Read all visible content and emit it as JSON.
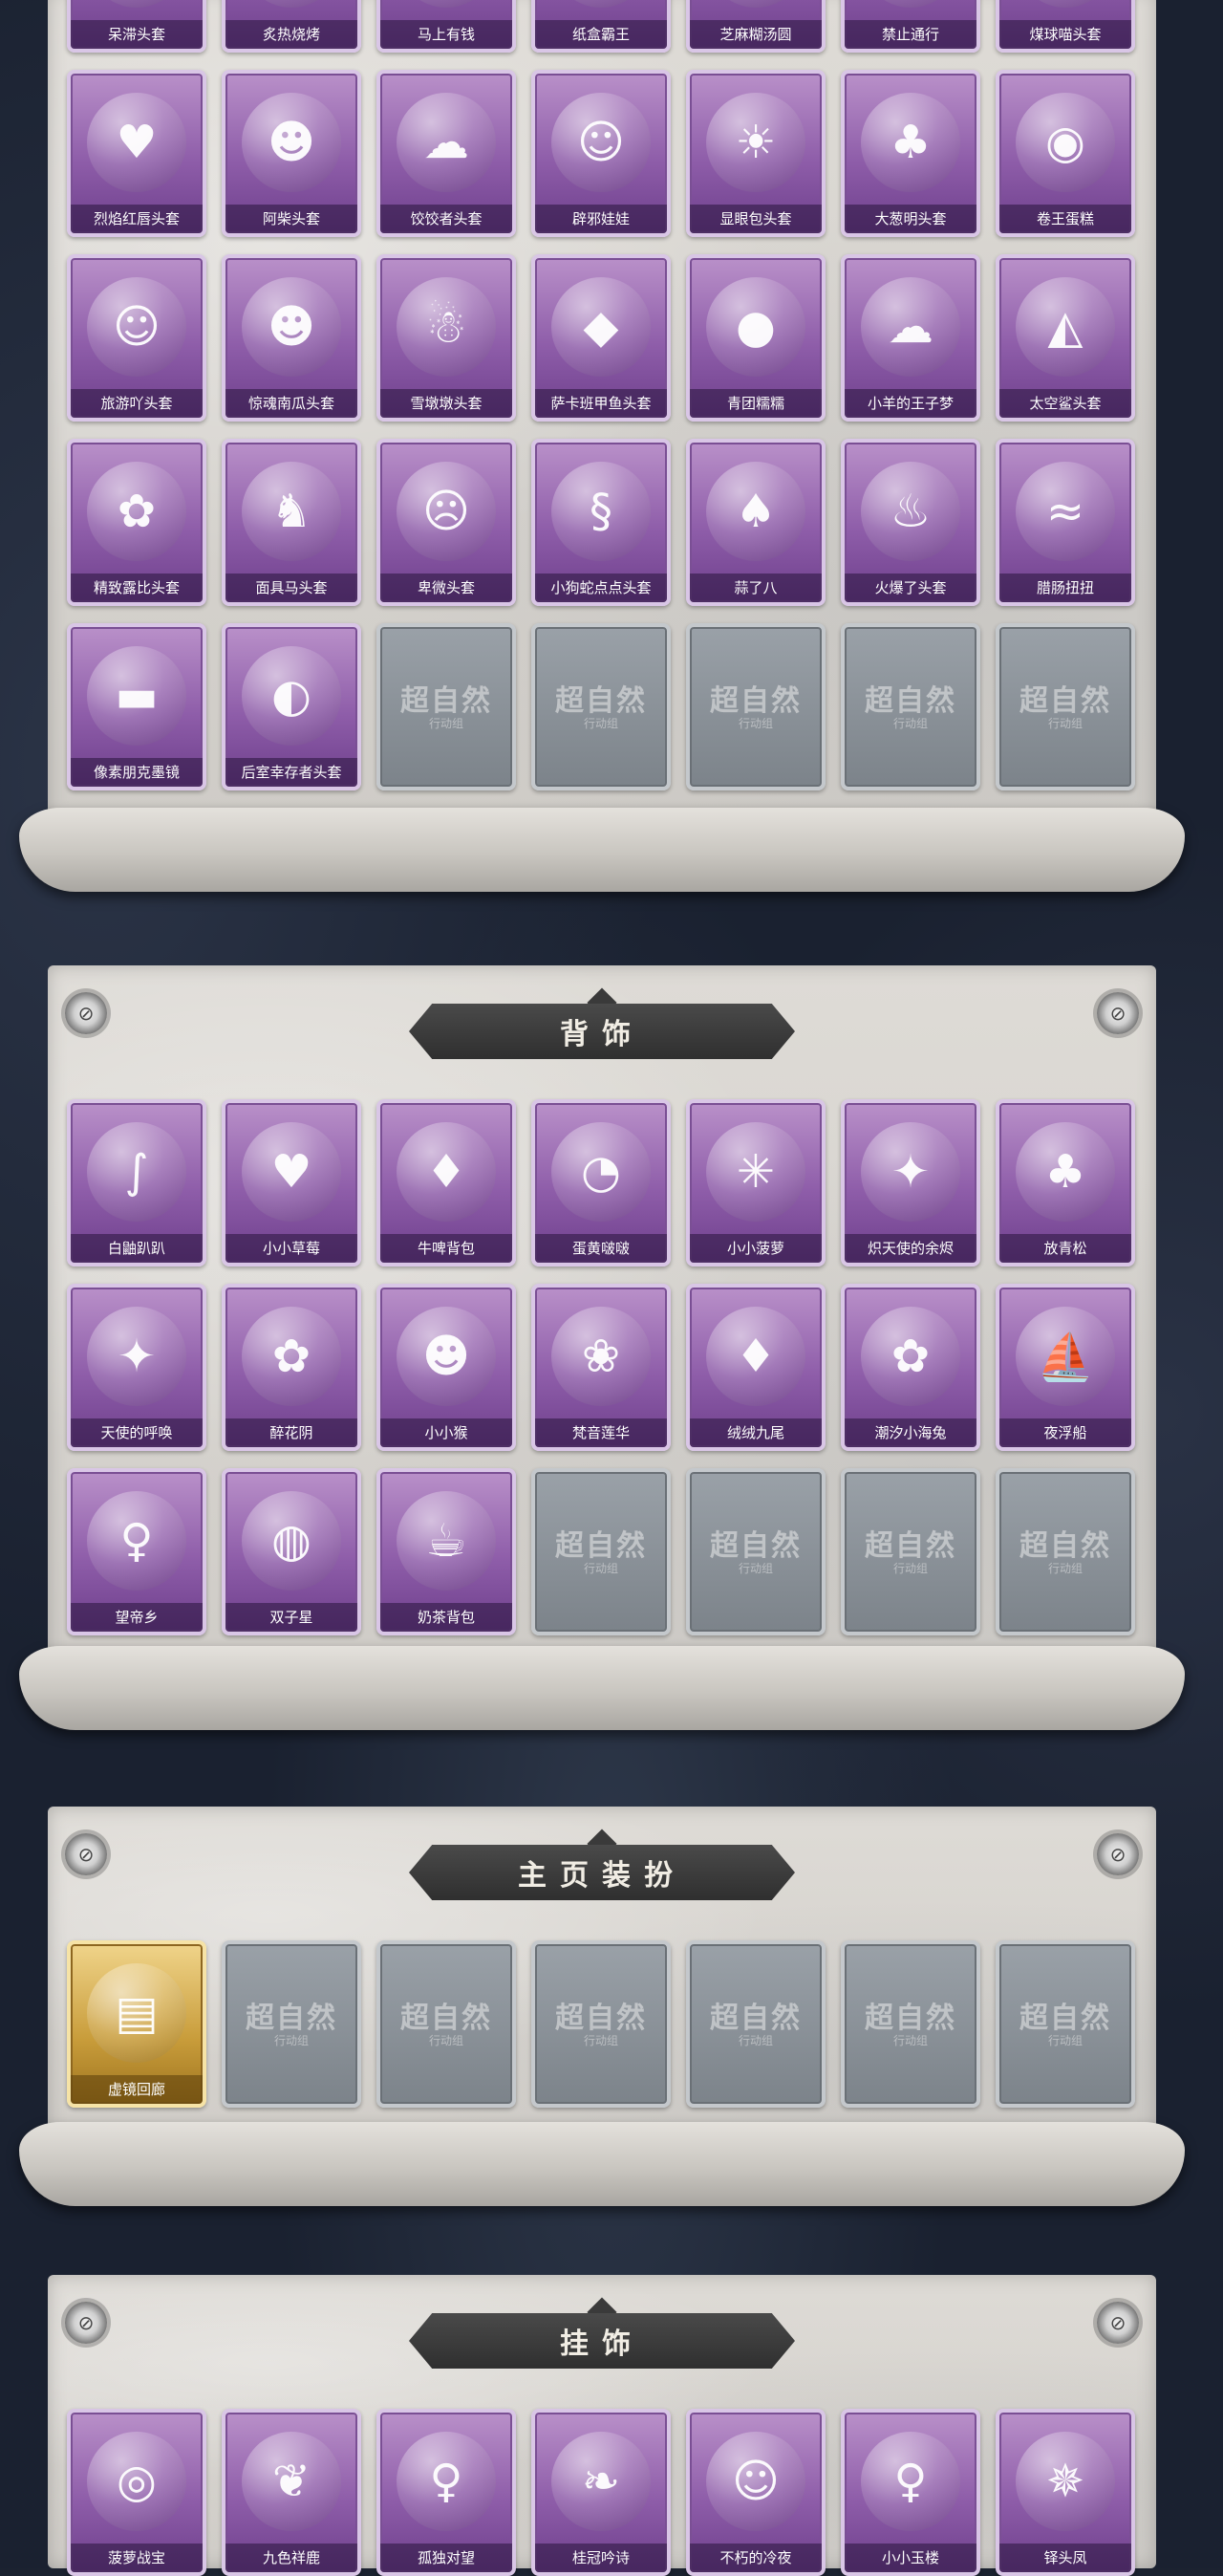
{
  "placeholder_watermark": {
    "main": "超自然",
    "sub": "行动组"
  },
  "sections": [
    {
      "id": "headwear",
      "title": "",
      "rows": [
        [
          "呆滞头套",
          "炙热烧烤",
          "马上有钱",
          "纸盒霸王",
          "芝麻糊汤圆",
          "禁止通行",
          "煤球喵头套"
        ],
        [
          "烈焰红唇头套",
          "阿柴头套",
          "饺饺者头套",
          "辟邪娃娃",
          "显眼包头套",
          "大葱明头套",
          "卷王蛋糕"
        ],
        [
          "旅游吖头套",
          "惊魂南瓜头套",
          "雪墩墩头套",
          "萨卡班甲鱼头套",
          "青团糯糯",
          "小羊的王子梦",
          "太空鲨头套"
        ],
        [
          "精致露比头套",
          "面具马头套",
          "卑微头套",
          "小狗蛇点点头套",
          "蒜了八",
          "火爆了头套",
          "腊肠扭扭"
        ],
        [
          "像素朋克墨镜",
          "后室幸存者头套",
          "",
          "",
          "",
          "",
          ""
        ]
      ]
    },
    {
      "id": "back",
      "title": "背饰",
      "rows": [
        [
          "白鼬趴趴",
          "小小草莓",
          "牛啤背包",
          "蛋黄啵啵",
          "小小菠萝",
          "炽天使的余烬",
          "放青松"
        ],
        [
          "天使的呼唤",
          "醉花阴",
          "小小猴",
          "梵音莲华",
          "绒绒九尾",
          "潮汐小海兔",
          "夜浮船"
        ],
        [
          "望帝乡",
          "双子星",
          "奶茶背包",
          "",
          "",
          "",
          ""
        ]
      ]
    },
    {
      "id": "homepage",
      "title": "主页装扮",
      "rows": [
        [
          "虚镜回廊",
          "",
          "",
          "",
          "",
          "",
          ""
        ]
      ]
    },
    {
      "id": "pendant",
      "title": "挂饰",
      "rows": [
        [
          "菠萝战宝",
          "九色祥鹿",
          "孤独对望",
          "桂冠吟诗",
          "不朽的冷夜",
          "小小玉楼",
          "铎头凤"
        ]
      ]
    }
  ],
  "icons": {
    "headwear": [
      "face",
      "fire",
      "coin",
      "box",
      "ball",
      "no-entry",
      "cat",
      "lips",
      "dog",
      "cloud",
      "doll",
      "bulb",
      "leek",
      "cake",
      "duck",
      "pumpkin",
      "snowman",
      "fish",
      "bun",
      "sheep",
      "shark",
      "bunny",
      "horse",
      "sad",
      "snake",
      "garlic",
      "flame",
      "sausage",
      "sunglasses",
      "gas-mask"
    ],
    "back": [
      "ferret",
      "strawberry",
      "beer",
      "chick",
      "pineapple",
      "angel",
      "pine",
      "angel",
      "flower",
      "monkey",
      "lotus",
      "fox",
      "bunny",
      "ship",
      "girl",
      "planet",
      "tea"
    ],
    "homepage": [
      "ticket"
    ],
    "pendant": [
      "robot",
      "deer",
      "figure",
      "leaf",
      "cat",
      "girl",
      "phoenix"
    ]
  },
  "colors": {
    "tile_purple": "#8e5da9",
    "tile_gold": "#c89c3a",
    "tile_gray": "#7c838a",
    "banner": "#3a3a3a",
    "board": "#d6d3ce",
    "background": "#1a2130"
  }
}
